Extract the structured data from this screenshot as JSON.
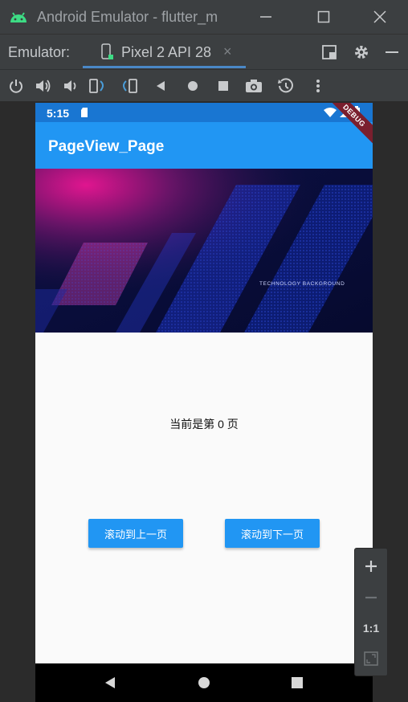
{
  "window": {
    "title": "Android Emulator - flutter_m",
    "minimize": "minimize",
    "maximize": "maximize",
    "close": "close"
  },
  "tabbar": {
    "emulator_label": "Emulator:",
    "device_tab_label": "Pixel 2 API 28",
    "close_glyph": "×"
  },
  "toolbar": {
    "icons": [
      "power-icon",
      "volume-up-icon",
      "volume-down-icon",
      "rotate-left-icon",
      "rotate-right-icon",
      "back-icon",
      "home-icon",
      "overview-icon",
      "screenshot-icon",
      "snapshot-icon",
      "more-icon"
    ]
  },
  "phone": {
    "status_time": "5:15",
    "app_title": "PageView_Page",
    "debug_banner": "DEBUG",
    "banner_text": "TECHNOLOGY BACKGROUND",
    "page_text": "当前是第 0 页",
    "prev_button": "滚动到上一页",
    "next_button": "滚动到下一页",
    "colors": {
      "status_bar": "#1976d2",
      "app_bar": "#2196f3",
      "button": "#2196f3"
    }
  },
  "zoom": {
    "ratio_label": "1:1"
  }
}
